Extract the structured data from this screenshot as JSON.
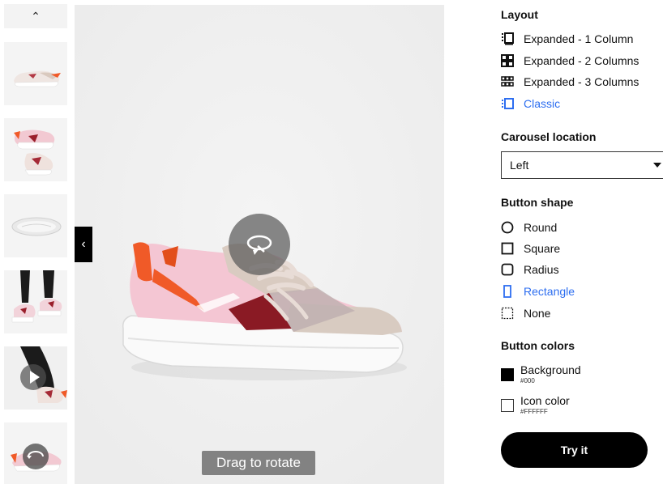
{
  "carousel": {
    "scroll_up_icon": "chevron-up-icon",
    "thumbnails": [
      {
        "name": "shoe-side-view"
      },
      {
        "name": "shoe-pair-view"
      },
      {
        "name": "shoe-sole-view"
      },
      {
        "name": "shoe-worn-view"
      },
      {
        "name": "shoe-video-view"
      },
      {
        "name": "shoe-360-view"
      }
    ]
  },
  "viewer": {
    "prev_icon": "chevron-left-icon",
    "rotate_icon": "rotate-360-icon",
    "drag_label": "Drag to rotate"
  },
  "settings": {
    "layout": {
      "heading": "Layout",
      "options": [
        {
          "label": "Expanded - 1 Column",
          "icon": "layout-1-column-icon",
          "selected": false
        },
        {
          "label": "Expanded - 2 Columns",
          "icon": "layout-2-columns-icon",
          "selected": false
        },
        {
          "label": "Expanded - 3 Columns",
          "icon": "layout-3-columns-icon",
          "selected": false
        },
        {
          "label": "Classic",
          "icon": "layout-classic-icon",
          "selected": true
        }
      ]
    },
    "carousel_location": {
      "heading": "Carousel location",
      "selected": "Left"
    },
    "button_shape": {
      "heading": "Button shape",
      "options": [
        {
          "label": "Round",
          "icon": "round-shape-icon",
          "selected": false
        },
        {
          "label": "Square",
          "icon": "square-shape-icon",
          "selected": false
        },
        {
          "label": "Radius",
          "icon": "radius-shape-icon",
          "selected": false
        },
        {
          "label": "Rectangle",
          "icon": "rectangle-shape-icon",
          "selected": true
        },
        {
          "label": "None",
          "icon": "none-shape-icon",
          "selected": false
        }
      ]
    },
    "button_colors": {
      "heading": "Button colors",
      "background": {
        "label": "Background",
        "hex": "#000",
        "color": "#000000"
      },
      "icon_color": {
        "label": "Icon color",
        "hex": "#FFFFFF",
        "color": "#FFFFFF"
      }
    },
    "try_label": "Try it"
  },
  "colors": {
    "accent": "#2d6ef0",
    "viewer_bg": "#f0f0f0"
  }
}
